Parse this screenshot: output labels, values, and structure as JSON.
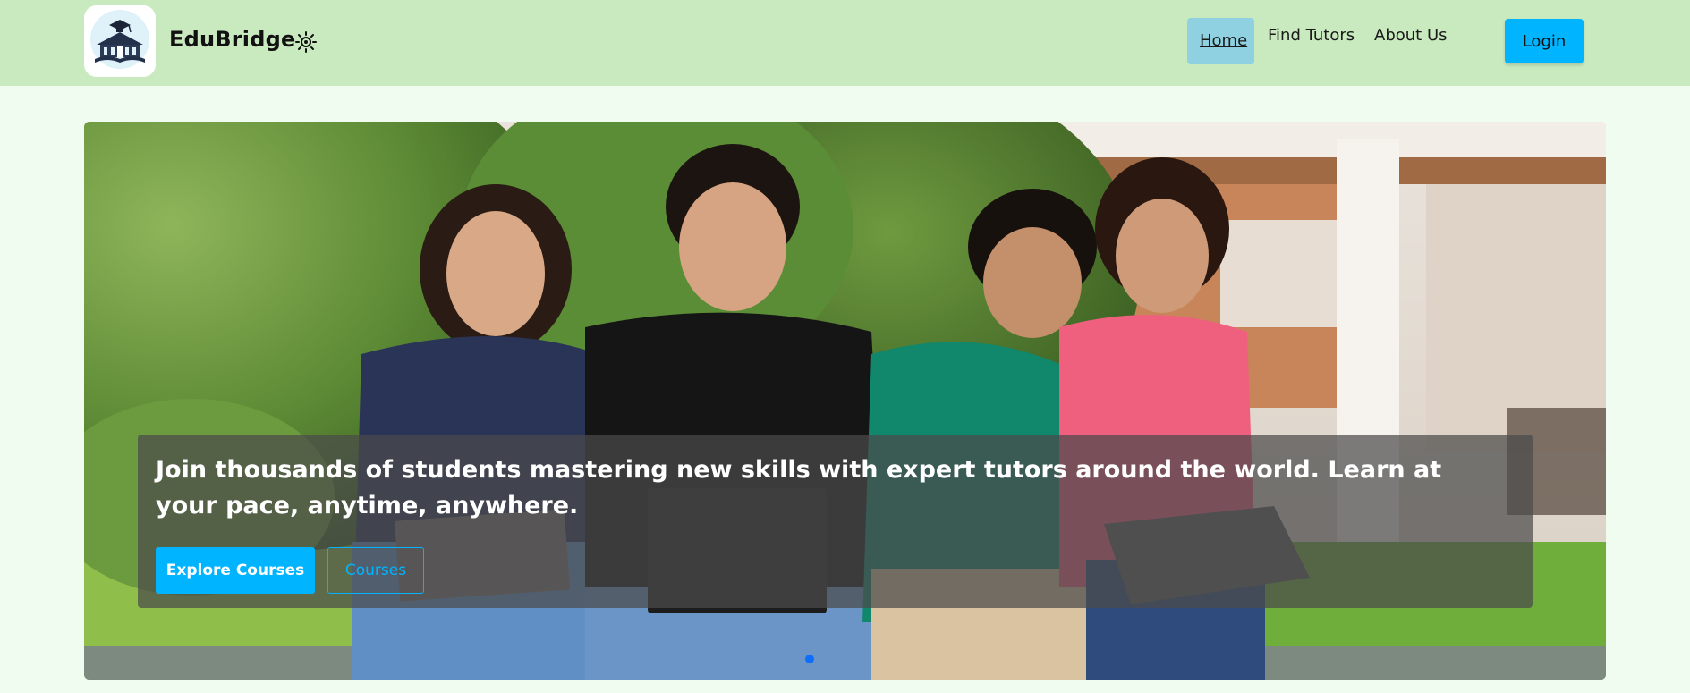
{
  "navbar": {
    "logo_text": "EDUBRIDGE",
    "brand": "EduBridge",
    "theme_toggle_icon": "sun-icon",
    "links": [
      {
        "label": "Home",
        "active": true
      },
      {
        "label": "Find Tutors"
      },
      {
        "label": "About Us"
      }
    ],
    "login_label": "Login"
  },
  "hero": {
    "caption": "Join thousands of students mastering new skills with expert tutors around the world. Learn at your pace, anytime, anywhere.",
    "primary_button": "Explore Courses",
    "secondary_button": "Courses",
    "active_slide": 1,
    "slide_count": 1
  },
  "colors": {
    "navbar_bg": "#c9e9bf",
    "page_bg": "#effcef",
    "accent": "#00b4ff",
    "active_link_bg": "#8fd1e0",
    "indicator": "#0d6efd"
  }
}
